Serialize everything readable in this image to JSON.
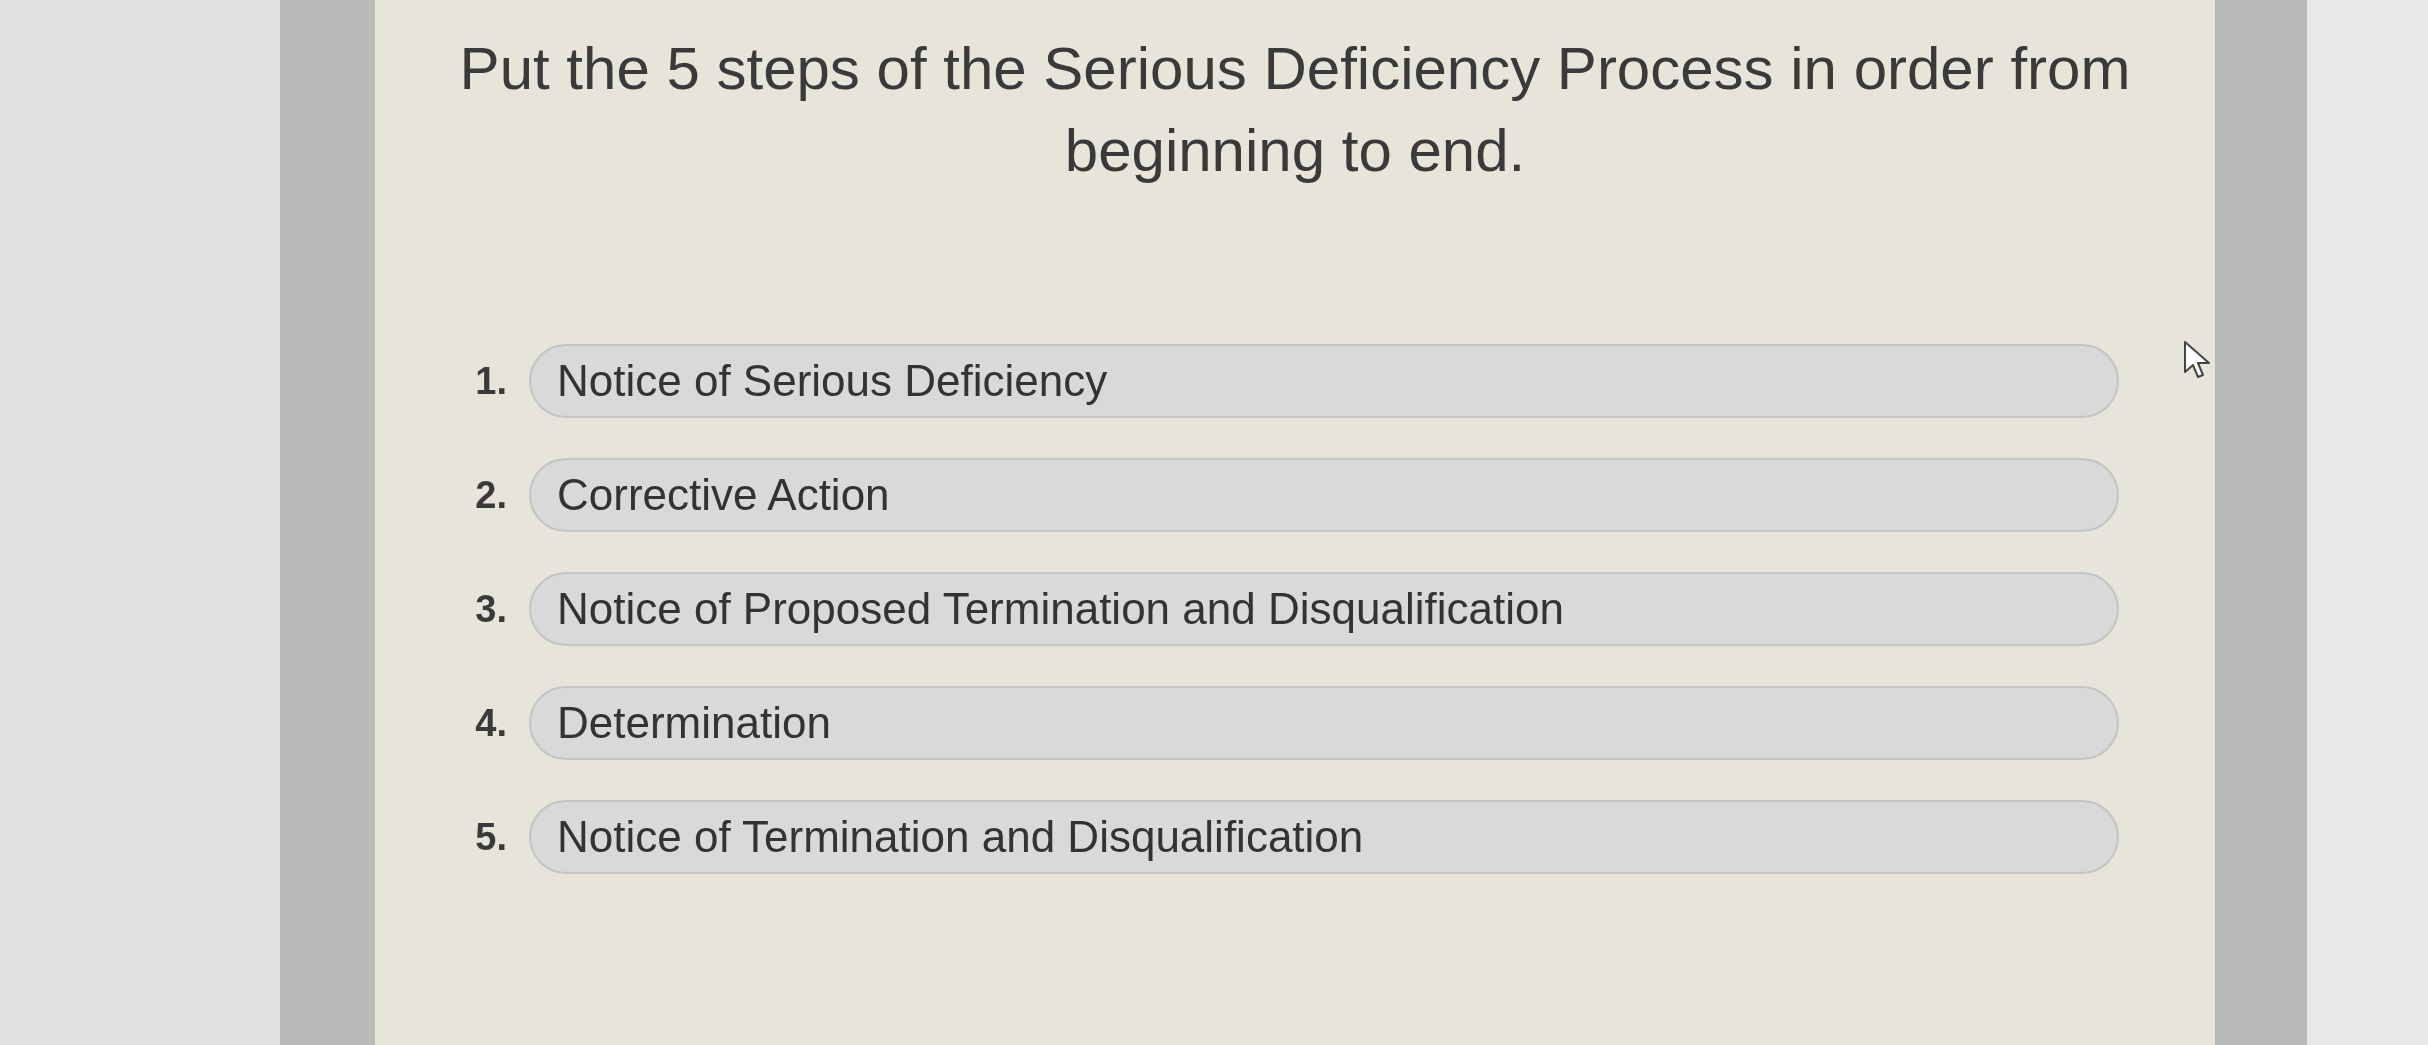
{
  "question": {
    "text": "Put the 5 steps of the Serious Deficiency Process in order from beginning to end."
  },
  "steps": [
    {
      "number": "1.",
      "label": "Notice of Serious Deficiency"
    },
    {
      "number": "2.",
      "label": "Corrective Action"
    },
    {
      "number": "3.",
      "label": "Notice of Proposed Termination and Disqualification"
    },
    {
      "number": "4.",
      "label": "Determination"
    },
    {
      "number": "5.",
      "label": "Notice of Termination and Disqualification"
    }
  ]
}
